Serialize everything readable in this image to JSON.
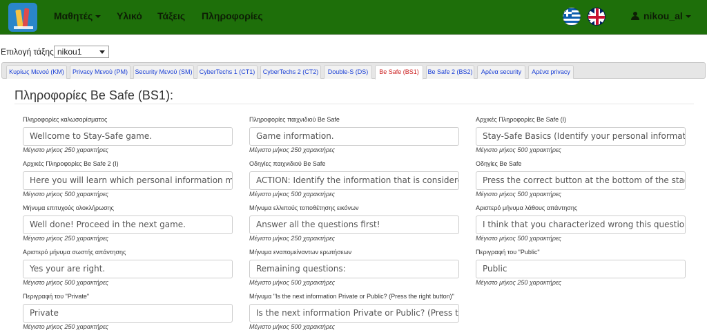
{
  "navbar": {
    "menu": [
      {
        "label": "Μαθητές",
        "has_caret": true
      },
      {
        "label": "Υλικό"
      },
      {
        "label": "Τάξεις"
      },
      {
        "label": "Πληροφορίες"
      }
    ],
    "user": "nikou_al",
    "colors": {
      "background": "#1e6f0a",
      "text": "#0d1e05"
    }
  },
  "class_select": {
    "label": "Επιλογή τάξης:",
    "value": "nikou1"
  },
  "tabs": [
    {
      "label": "Κυρίως Μενού (KM)"
    },
    {
      "label": "Privacy Μενού (PM)"
    },
    {
      "label": "Security Μενού (SM)"
    },
    {
      "label": "CyberTechs 1 (CT1)"
    },
    {
      "label": "CyberTechs 2 (CT2)"
    },
    {
      "label": "Double-S (DS)"
    },
    {
      "label": "Be Safe (BS1)",
      "active": true
    },
    {
      "label": "Be Safe 2 (BS2)"
    },
    {
      "label": "Αρένα security"
    },
    {
      "label": "Αρένα privacy"
    }
  ],
  "panel": {
    "title": "Πληροφορίες Be Safe (BS1):",
    "fields": [
      {
        "label": "Πληροφορίες καλωσορίσματος",
        "value": "Wellcome to Stay-Safe game.",
        "hint": "Μέγιστο μήκος 250 χαρακτήρες"
      },
      {
        "label": "Πληροφορίες παιχνιδιού Be Safe",
        "value": "Game information.",
        "hint": "Μέγιστο μήκος 250 χαρακτήρες"
      },
      {
        "label": "Αρχικές Πληροφορίες Be Safe (I)",
        "value": "Stay-Safe Basics (Identify your personal information)",
        "hint": "Μέγιστο μήκος 500 χαρακτήρες"
      },
      {
        "label": "Αρχικές Πληροφορίες Be Safe 2 (I)",
        "value": "Here you will learn which personal information must be kept private",
        "hint": "Μέγιστο μήκος 500 χαρακτήρες"
      },
      {
        "label": "Οδηγίες παιχνιδιού Be Safe",
        "value": "ACTION: Identify the information that is considered private",
        "hint": "Μέγιστο μήκος 500 χαρακτήρες"
      },
      {
        "label": "Οδηγίες Be Safe",
        "value": "Press the correct button at the bottom of the stage",
        "hint": "Μέγιστο μήκος 500 χαρακτήρες"
      },
      {
        "label": "Μήνυμα επιτυχούς ολοκλήρωσης",
        "value": "Well done! Proceed in the next game.",
        "hint": "Μέγιστο μήκος 250 χαρακτήρες"
      },
      {
        "label": "Μήνυμα ελλιπούς τοποθέτησης εικόνων",
        "value": "Answer all the questions first!",
        "hint": "Μέγιστο μήκος 250 χαρακτήρες"
      },
      {
        "label": "Αριστερό μήνυμα λάθους απάντησης",
        "value": "I think that you characterized wrong this question",
        "hint": "Μέγιστο μήκος 500 χαρακτήρες"
      },
      {
        "label": "Αριστερό μήνυμα σωστής απάντησης",
        "value": "Yes your are right.",
        "hint": "Μέγιστο μήκος 500 χαρακτήρες"
      },
      {
        "label": "Μήνυμα εναπομείναντων ερωτήσεων",
        "value": "Remaining questions:",
        "hint": "Μέγιστο μήκος 500 χαρακτήρες"
      },
      {
        "label": "Περιγραφή του \"Public\"",
        "value": "Public",
        "hint": "Μέγιστο μήκος 250 χαρακτήρες"
      },
      {
        "label": "Περιγραφή του \"Private\"",
        "value": "Private",
        "hint": "Μέγιστο μήκος 250 χαρακτήρες"
      },
      {
        "label": "Μήνυμα \"Is the next information Private or Public? (Press the right button)\"",
        "value": "Is the next information Private or Public? (Press the right button)",
        "hint": "Μέγιστο μήκος 500 χαρακτήρες"
      }
    ]
  }
}
